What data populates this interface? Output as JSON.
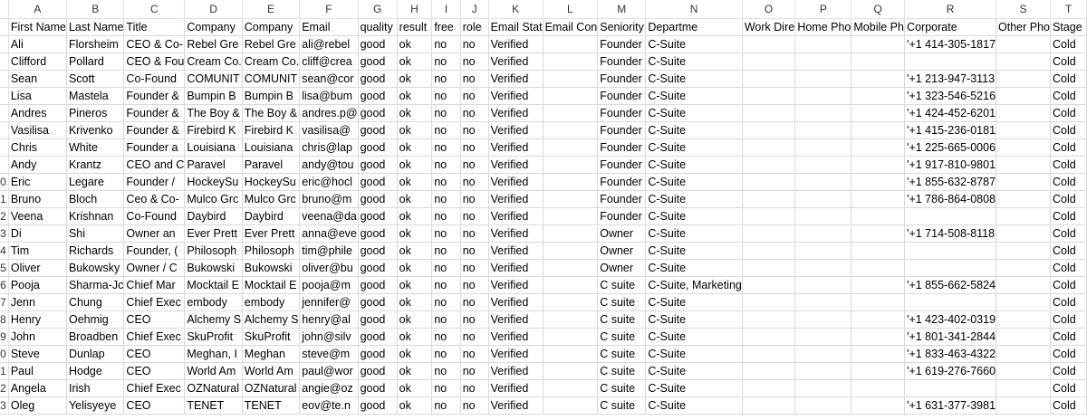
{
  "columns": [
    "A",
    "B",
    "C",
    "D",
    "E",
    "F",
    "G",
    "H",
    "I",
    "J",
    "K",
    "L",
    "M",
    "N",
    "O",
    "P",
    "Q",
    "R",
    "S",
    "T"
  ],
  "headers": [
    "First Name",
    "Last Name",
    "Title",
    "Company",
    "Company",
    "Email",
    "quality",
    "result",
    "free",
    "role",
    "Email Stat",
    "Email Con",
    "Seniority",
    "Departme",
    "Work Dire",
    "Home Pho",
    "Mobile Ph",
    "Corporate",
    "Other Pho",
    "Stage"
  ],
  "rows": [
    {
      "num": "",
      "cells": [
        "Ali",
        "Florsheim",
        "CEO & Co-",
        "Rebel Gre",
        "Rebel Gre",
        "ali@rebel",
        "good",
        "ok",
        "no",
        "no",
        "Verified",
        "",
        "Founder",
        "C-Suite",
        "",
        "",
        "",
        "'+1 414-305-1817",
        "",
        "Cold"
      ]
    },
    {
      "num": "",
      "cells": [
        "Clifford",
        "Pollard",
        "CEO & Fou",
        "Cream Co.",
        "Cream Co.",
        "cliff@crea",
        "good",
        "ok",
        "no",
        "no",
        "Verified",
        "",
        "Founder",
        "C-Suite",
        "",
        "",
        "",
        "",
        "",
        "Cold"
      ]
    },
    {
      "num": "",
      "cells": [
        "Sean",
        "Scott",
        "Co-Found",
        "COMUNIT",
        "COMUNIT",
        "sean@cor",
        "good",
        "ok",
        "no",
        "no",
        "Verified",
        "",
        "Founder",
        "C-Suite",
        "",
        "",
        "",
        "'+1 213-947-3113",
        "",
        "Cold"
      ]
    },
    {
      "num": "",
      "cells": [
        "Lisa",
        "Mastela",
        "Founder &",
        "Bumpin B",
        "Bumpin B",
        "lisa@bum",
        "good",
        "ok",
        "no",
        "no",
        "Verified",
        "",
        "Founder",
        "C-Suite",
        "",
        "",
        "",
        "'+1 323-546-5216",
        "",
        "Cold"
      ]
    },
    {
      "num": "",
      "cells": [
        "Andres",
        "Pineros",
        "Founder &",
        "The Boy &",
        "The Boy &",
        "andres.p@",
        "good",
        "ok",
        "no",
        "no",
        "Verified",
        "",
        "Founder",
        "C-Suite",
        "",
        "",
        "",
        "'+1 424-452-6201",
        "",
        "Cold"
      ]
    },
    {
      "num": "",
      "cells": [
        "Vasilisa",
        "Krivenko",
        "Founder &",
        "Firebird K",
        "Firebird K",
        "vasilisa@",
        "good",
        "ok",
        "no",
        "no",
        "Verified",
        "",
        "Founder",
        "C-Suite",
        "",
        "",
        "",
        "'+1 415-236-0181",
        "",
        "Cold"
      ]
    },
    {
      "num": "",
      "cells": [
        "Chris",
        "White",
        "Founder a",
        "Louisiana",
        "Louisiana",
        "chris@lap",
        "good",
        "ok",
        "no",
        "no",
        "Verified",
        "",
        "Founder",
        "C-Suite",
        "",
        "",
        "",
        "'+1 225-665-0006",
        "",
        "Cold"
      ]
    },
    {
      "num": "",
      "cells": [
        "Andy",
        "Krantz",
        "CEO and C",
        "Paravel",
        "Paravel",
        "andy@tou",
        "good",
        "ok",
        "no",
        "no",
        "Verified",
        "",
        "Founder",
        "C-Suite",
        "",
        "",
        "",
        "'+1 917-810-9801",
        "",
        "Cold"
      ]
    },
    {
      "num": "0",
      "cells": [
        "Eric",
        "Legare",
        "Founder /",
        "HockeySu",
        "HockeySu",
        "eric@hocl",
        "good",
        "ok",
        "no",
        "no",
        "Verified",
        "",
        "Founder",
        "C-Suite",
        "",
        "",
        "",
        "'+1 855-632-8787",
        "",
        "Cold"
      ]
    },
    {
      "num": "1",
      "cells": [
        "Bruno",
        "Bloch",
        "Ceo & Co-",
        "Mulco Grc",
        "Mulco Grc",
        "bruno@m",
        "good",
        "ok",
        "no",
        "no",
        "Verified",
        "",
        "Founder",
        "C-Suite",
        "",
        "",
        "",
        "'+1 786-864-0808",
        "",
        "Cold"
      ]
    },
    {
      "num": "2",
      "cells": [
        "Veena",
        "Krishnan",
        "Co-Found",
        "Daybird",
        "Daybird",
        "veena@da",
        "good",
        "ok",
        "no",
        "no",
        "Verified",
        "",
        "Founder",
        "C-Suite",
        "",
        "",
        "",
        "",
        "",
        "Cold"
      ]
    },
    {
      "num": "3",
      "cells": [
        "Di",
        "Shi",
        "Owner an",
        "Ever Prett",
        "Ever Prett",
        "anna@eve",
        "good",
        "ok",
        "no",
        "no",
        "Verified",
        "",
        "Owner",
        "C-Suite",
        "",
        "",
        "",
        "'+1 714-508-8118",
        "",
        "Cold"
      ]
    },
    {
      "num": "4",
      "cells": [
        "Tim",
        "Richards",
        "Founder, (",
        "Philosoph",
        "Philosoph",
        "tim@phile",
        "good",
        "ok",
        "no",
        "no",
        "Verified",
        "",
        "Owner",
        "C-Suite",
        "",
        "",
        "",
        "",
        "",
        "Cold"
      ]
    },
    {
      "num": "5",
      "cells": [
        "Oliver",
        "Bukowsky",
        "Owner / C",
        "Bukowski",
        "Bukowski",
        "oliver@bu",
        "good",
        "ok",
        "no",
        "no",
        "Verified",
        "",
        "Owner",
        "C-Suite",
        "",
        "",
        "",
        "",
        "",
        "Cold"
      ]
    },
    {
      "num": "6",
      "cells": [
        "Pooja",
        "Sharma-Jc",
        "Chief Mar",
        "Mocktail E",
        "Mocktail E",
        "pooja@m",
        "good",
        "ok",
        "no",
        "no",
        "Verified",
        "",
        "C suite",
        "C-Suite, Marketing",
        "",
        "",
        "",
        "'+1 855-662-5824",
        "",
        "Cold"
      ]
    },
    {
      "num": "7",
      "cells": [
        "Jenn",
        "Chung",
        "Chief Exec",
        "embody",
        "embody",
        "jennifer@",
        "good",
        "ok",
        "no",
        "no",
        "Verified",
        "",
        "C suite",
        "C-Suite",
        "",
        "",
        "",
        "",
        "",
        "Cold"
      ]
    },
    {
      "num": "8",
      "cells": [
        "Henry",
        "Oehmig",
        "CEO",
        "Alchemy S",
        "Alchemy S",
        "henry@al",
        "good",
        "ok",
        "no",
        "no",
        "Verified",
        "",
        "C suite",
        "C-Suite",
        "",
        "",
        "",
        "'+1 423-402-0319",
        "",
        "Cold"
      ]
    },
    {
      "num": "9",
      "cells": [
        "John",
        "Broadben",
        "Chief Exec",
        "SkuProfit",
        "SkuProfit",
        "john@silv",
        "good",
        "ok",
        "no",
        "no",
        "Verified",
        "",
        "C suite",
        "C-Suite",
        "",
        "",
        "",
        "'+1 801-341-2844",
        "",
        "Cold"
      ]
    },
    {
      "num": "0",
      "cells": [
        "Steve",
        "Dunlap",
        "CEO",
        "Meghan, I",
        "Meghan",
        "steve@m",
        "good",
        "ok",
        "no",
        "no",
        "Verified",
        "",
        "C suite",
        "C-Suite",
        "",
        "",
        "",
        "'+1 833-463-4322",
        "",
        "Cold"
      ]
    },
    {
      "num": "1",
      "cells": [
        "Paul",
        "Hodge",
        "CEO",
        "World Am",
        "World Am",
        "paul@wor",
        "good",
        "ok",
        "no",
        "no",
        "Verified",
        "",
        "C suite",
        "C-Suite",
        "",
        "",
        "",
        "'+1 619-276-7660",
        "",
        "Cold"
      ]
    },
    {
      "num": "2",
      "cells": [
        "Angela",
        "Irish",
        "Chief Exec",
        "OZNatural",
        "OZNatural",
        "angie@oz",
        "good",
        "ok",
        "no",
        "no",
        "Verified",
        "",
        "C suite",
        "C-Suite",
        "",
        "",
        "",
        "",
        "",
        "Cold"
      ]
    },
    {
      "num": "3",
      "cells": [
        "Oleg",
        "Yelisyeye",
        "CEO",
        "TENET",
        "TENET",
        "eov@te.n",
        "good",
        "ok",
        "no",
        "no",
        "Verified",
        "",
        "C suite",
        "C-Suite",
        "",
        "",
        "",
        "'+1 631-377-3981",
        "",
        "Cold"
      ]
    }
  ]
}
